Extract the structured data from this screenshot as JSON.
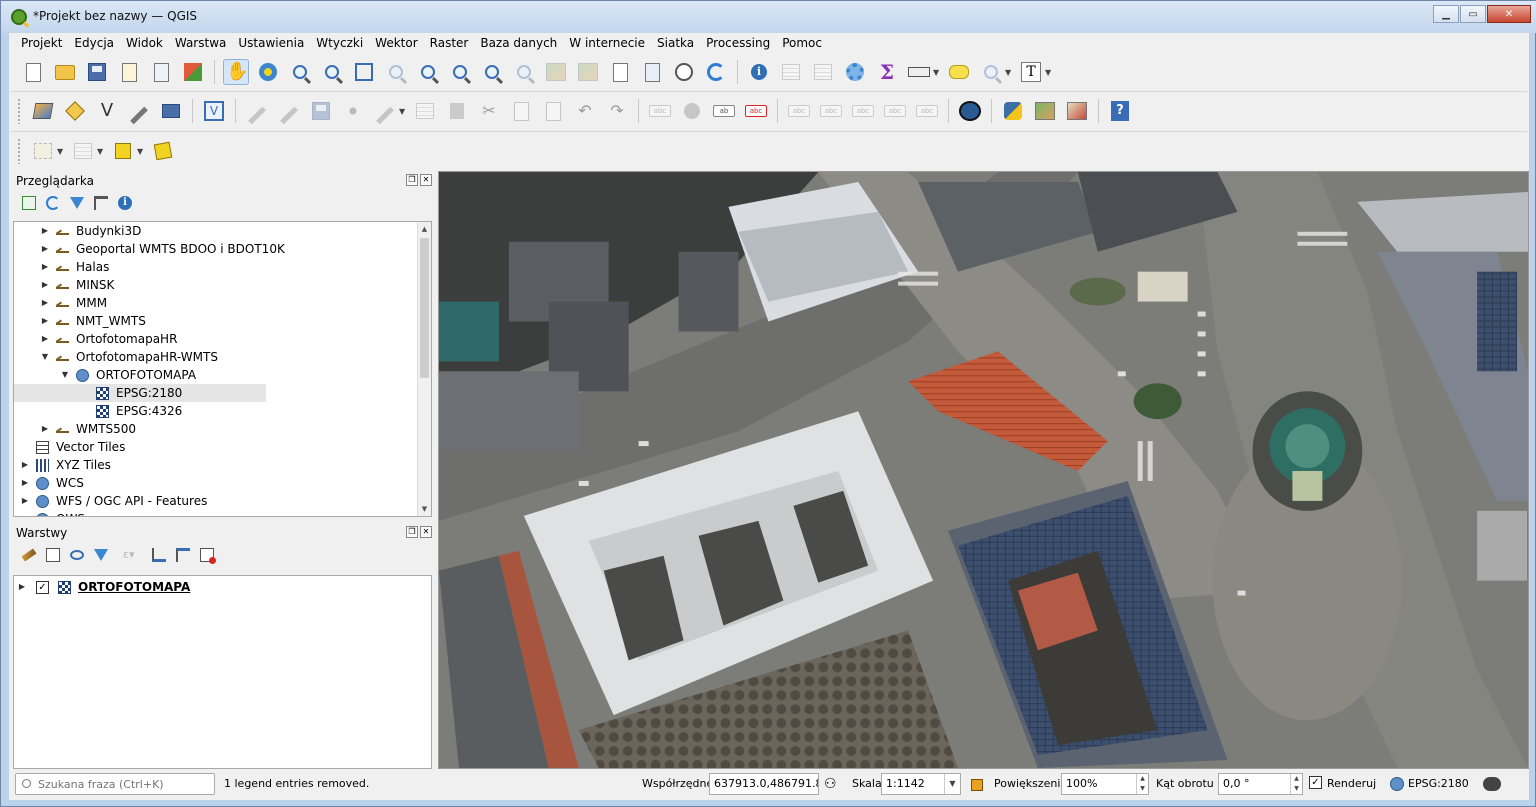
{
  "window": {
    "title": "*Projekt bez nazwy — QGIS",
    "minimize_glyph": "▁",
    "maximize_glyph": "▭",
    "close_glyph": "✕"
  },
  "menu": [
    "Projekt",
    "Edycja",
    "Widok",
    "Warstwa",
    "Ustawienia",
    "Wtyczki",
    "Wektor",
    "Raster",
    "Baza danych",
    "W internecie",
    "Siatka",
    "Processing",
    "Pomoc"
  ],
  "browser_panel": {
    "title": "Przeglądarka",
    "tools": [
      "add-selected-icon",
      "refresh-icon",
      "filter-icon",
      "collapse-all-icon",
      "info-icon"
    ],
    "items": [
      {
        "label": "Budynki3D",
        "icon": "wms-icon",
        "level": 1,
        "expanded": false
      },
      {
        "label": "Geoportal WMTS BDOO i BDOT10K",
        "icon": "wms-icon",
        "level": 1,
        "expanded": false
      },
      {
        "label": "Halas",
        "icon": "wms-icon",
        "level": 1,
        "expanded": false
      },
      {
        "label": "MINSK",
        "icon": "wms-icon",
        "level": 1,
        "expanded": false
      },
      {
        "label": "MMM",
        "icon": "wms-icon",
        "level": 1,
        "expanded": false
      },
      {
        "label": "NMT_WMTS",
        "icon": "wms-icon",
        "level": 1,
        "expanded": false
      },
      {
        "label": "OrtofotomapaHR",
        "icon": "wms-icon",
        "level": 1,
        "expanded": false
      },
      {
        "label": "OrtofotomapaHR-WMTS",
        "icon": "wms-icon",
        "level": 1,
        "expanded": true
      },
      {
        "label": "ORTOFOTOMAPA",
        "icon": "globe-icon",
        "level": 2,
        "expanded": true
      },
      {
        "label": "EPSG:2180",
        "icon": "raster-icon",
        "level": 3,
        "selected": true
      },
      {
        "label": "EPSG:4326",
        "icon": "raster-icon",
        "level": 3
      },
      {
        "label": "WMTS500",
        "icon": "wms-icon",
        "level": 1,
        "expanded": false
      },
      {
        "label": "Vector Tiles",
        "icon": "vector-tiles-icon",
        "level": 0
      },
      {
        "label": "XYZ Tiles",
        "icon": "xyz-tiles-icon",
        "level": 0,
        "expanded": false
      },
      {
        "label": "WCS",
        "icon": "globe-icon",
        "level": 0,
        "expanded": false
      },
      {
        "label": "WFS / OGC API - Features",
        "icon": "globe-icon",
        "level": 0,
        "expanded": false
      },
      {
        "label": "OWS",
        "icon": "globe-icon",
        "level": 0,
        "expanded": false
      }
    ]
  },
  "layers_panel": {
    "title": "Warstwy",
    "tools": [
      "style-icon",
      "add-group-icon",
      "visibility-icon",
      "filter-icon",
      "filter-expression-icon",
      "expand-all-icon",
      "collapse-all-icon",
      "remove-layer-icon"
    ],
    "layers": [
      {
        "label": "ORTOFOTOMAPA",
        "checked": true,
        "check_glyph": "✓"
      }
    ]
  },
  "statusbar": {
    "search_placeholder": "Szukana fraza (Ctrl+K)",
    "message": "1 legend entries removed.",
    "coords_label": "Współrzędne",
    "coords_value": "637913.0,486791.8",
    "scale_label": "Skala",
    "scale_value": "1:1142",
    "zoom_label": "Powiększenie",
    "zoom_value": "100%",
    "rotation_label": "Kąt obrotu",
    "rotation_value": "0,0 °",
    "render_label": "Renderuj",
    "render_checked": true,
    "render_check_glyph": "✓",
    "crs_label": "EPSG:2180"
  }
}
